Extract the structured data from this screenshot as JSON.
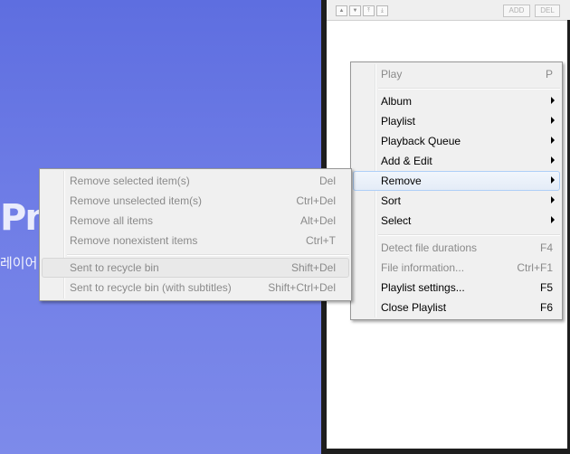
{
  "player": {
    "logo_text": "Pn",
    "logo_sub": "레이어"
  },
  "playlist_toolbar": {
    "add_label": "ADD",
    "del_label": "DEL"
  },
  "main_menu": {
    "items": [
      {
        "label": "Play",
        "shortcut": "P"
      },
      {
        "label": "Album"
      },
      {
        "label": "Playlist"
      },
      {
        "label": "Playback Queue"
      },
      {
        "label": "Add & Edit"
      },
      {
        "label": "Remove"
      },
      {
        "label": "Sort"
      },
      {
        "label": "Select"
      },
      {
        "label": "Detect file durations",
        "shortcut": "F4"
      },
      {
        "label": "File information...",
        "shortcut": "Ctrl+F1"
      },
      {
        "label": "Playlist settings...",
        "shortcut": "F5"
      },
      {
        "label": "Close Playlist",
        "shortcut": "F6"
      }
    ]
  },
  "remove_submenu": {
    "items": [
      {
        "label": "Remove selected item(s)",
        "shortcut": "Del"
      },
      {
        "label": "Remove unselected item(s)",
        "shortcut": "Ctrl+Del"
      },
      {
        "label": "Remove all items",
        "shortcut": "Alt+Del"
      },
      {
        "label": "Remove nonexistent items",
        "shortcut": "Ctrl+T"
      },
      {
        "label": "Sent to recycle bin",
        "shortcut": "Shift+Del"
      },
      {
        "label": "Sent to recycle bin (with subtitles)",
        "shortcut": "Shift+Ctrl+Del"
      }
    ]
  },
  "colors": {
    "player_background": "#6b7ae4",
    "menu_background": "#f0f0f0",
    "disabled_text": "#8a8a8a",
    "highlight_border": "#aecff7"
  }
}
